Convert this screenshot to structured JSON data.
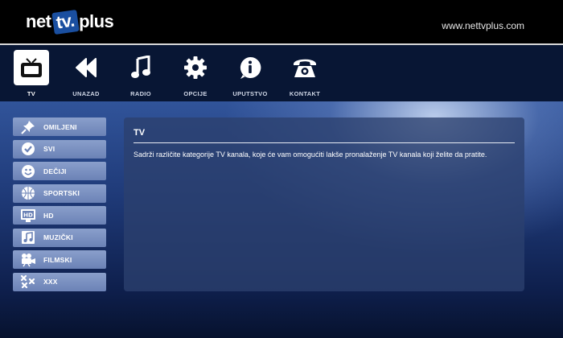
{
  "header": {
    "logo_pre": "net",
    "logo_tv": "tv",
    "logo_dot": ".",
    "logo_post": "plus",
    "url": "www.nettvplus.com"
  },
  "topnav": [
    {
      "label": "TV",
      "icon": "tv-icon",
      "active": true
    },
    {
      "label": "UNAZAD",
      "icon": "rewind-icon",
      "active": false
    },
    {
      "label": "RADIO",
      "icon": "music-note-icon",
      "active": false
    },
    {
      "label": "OPCIJE",
      "icon": "gear-icon",
      "active": false
    },
    {
      "label": "UPUTSTVO",
      "icon": "info-icon",
      "active": false
    },
    {
      "label": "KONTAKT",
      "icon": "telephone-icon",
      "active": false
    }
  ],
  "sidebar": [
    {
      "label": "OMILJENI",
      "icon": "pin-icon"
    },
    {
      "label": "SVI",
      "icon": "checkmark-icon"
    },
    {
      "label": "DEČIJI",
      "icon": "smiley-icon"
    },
    {
      "label": "SPORTSKI",
      "icon": "ball-icon"
    },
    {
      "label": "HD",
      "icon": "hd-icon"
    },
    {
      "label": "MUZIČKI",
      "icon": "music-icon"
    },
    {
      "label": "FILMSKI",
      "icon": "film-camera-icon"
    },
    {
      "label": "XXX",
      "icon": "xxx-icon"
    }
  ],
  "panel": {
    "title": "TV",
    "text": "Sadrži različite kategorije TV kanala, koje će vam omogućiti lakše pronalaženje TV kanala koji želite da pratite."
  },
  "colors": {
    "header_bg": "#000000",
    "nav_bg": "#081634",
    "sidebar_item": "#7a90c2",
    "panel_bg": "#2c406e",
    "logo_accent": "#1a4fa0"
  }
}
